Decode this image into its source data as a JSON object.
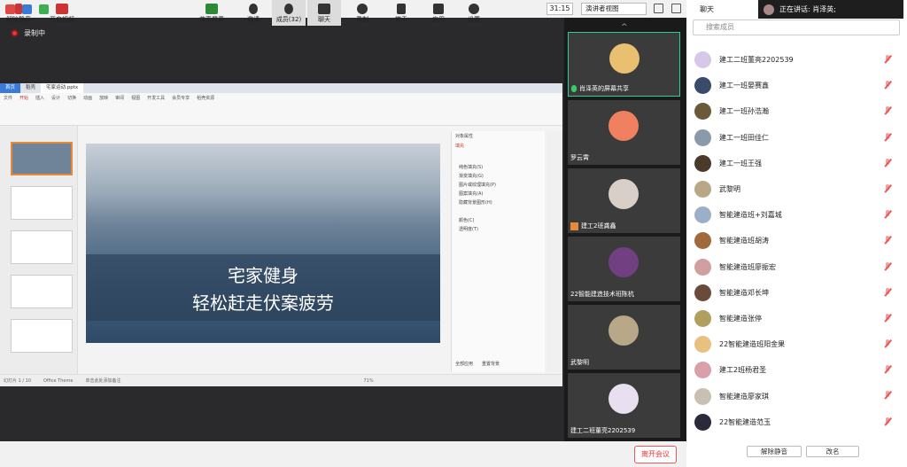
{
  "topbar": {
    "timer": "31:15",
    "view_label": "演讲者视图"
  },
  "recording": {
    "label": "录制中"
  },
  "ppt": {
    "tabs": [
      "首页",
      "稻壳",
      "宅家运动.pptx"
    ],
    "menu": [
      "文件",
      "开始",
      "插入",
      "设计",
      "切换",
      "动画",
      "放映",
      "审阅",
      "视图",
      "开发工具",
      "会员专享",
      "稻壳资源"
    ],
    "slide": {
      "title": "宅家健身",
      "subtitle": "轻松赶走伏案疲劳"
    },
    "notes_placeholder": "单击此处添加备注",
    "status_left": "幻灯片 1 / 10",
    "theme": "Office Theme",
    "zoom": "71%",
    "pane_title": "对象属性",
    "pane_section": "填充",
    "pane_options": [
      "纯色填充(S)",
      "渐变填充(G)",
      "图片或纹理填充(P)",
      "图案填充(A)",
      "隐藏背景图形(H)"
    ],
    "pane_color_label": "颜色(C)",
    "pane_transparency_label": "透明度(T)",
    "pane_apply_all": "全部应用",
    "pane_reset": "重置背景"
  },
  "video_tiles": [
    {
      "name": "肖泽英的屏幕共享",
      "color": "#e8c070"
    },
    {
      "name": "罗云霄",
      "color": "#f08060"
    },
    {
      "name": "建工2班龚鑫",
      "color": "#d8d0c8"
    },
    {
      "name": "22智能建造技术班陈杭",
      "color": "#704080"
    },
    {
      "name": "武黎明",
      "color": "#b8a888"
    },
    {
      "name": "建工二班董亮2202539",
      "color": "#e8e0f0"
    }
  ],
  "panel": {
    "title": "聊天",
    "speaking": "正在讲话: 肖泽英;",
    "search_placeholder": "搜索成员",
    "members": [
      {
        "name": "建工二班董亮2202539",
        "color": "#d8c8e8"
      },
      {
        "name": "建工一班晏赛鑫",
        "color": "#3a4a6a"
      },
      {
        "name": "建工一班孙浩瀚",
        "color": "#6a5a3a"
      },
      {
        "name": "建工一班田佳仁",
        "color": "#8a9aaa"
      },
      {
        "name": "建工一班王强",
        "color": "#4a3a2a"
      },
      {
        "name": "武黎明",
        "color": "#b8a888"
      },
      {
        "name": "智能建造班+刘嘉城",
        "color": "#9ab0c8"
      },
      {
        "name": "智能建造班胡涛",
        "color": "#a06a3a"
      },
      {
        "name": "智能建造班廖振宏",
        "color": "#d0a0a0"
      },
      {
        "name": "智能建造邓长坤",
        "color": "#6a4a3a"
      },
      {
        "name": "智能建造张停",
        "color": "#b0a060"
      },
      {
        "name": "22智能建造班阳金果",
        "color": "#e8c080"
      },
      {
        "name": "建工2班杨君圣",
        "color": "#d8a0a8"
      },
      {
        "name": "智能建造廖家琪",
        "color": "#c8c0b0"
      },
      {
        "name": "22智能建造范玉",
        "color": "#2a2a3a"
      }
    ],
    "unmute_all": "解除静音",
    "rename": "改名"
  },
  "bottombar": {
    "buttons": [
      "解除静音",
      "开启视频",
      "共享屏幕",
      "邀请",
      "成员(32)",
      "聊天",
      "录制",
      "举手",
      "应用",
      "设置"
    ],
    "leave": "离开会议"
  }
}
